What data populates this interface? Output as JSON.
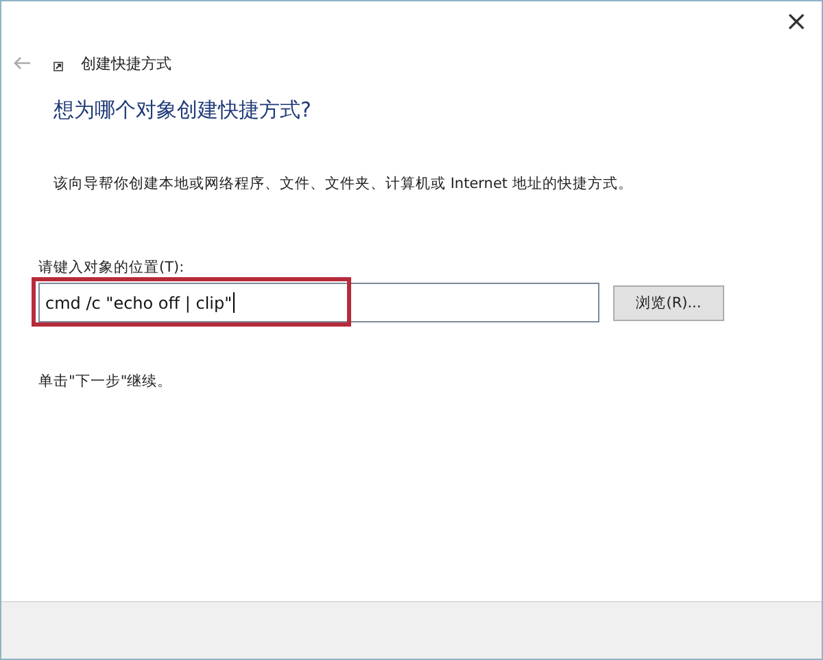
{
  "window": {
    "title": "创建快捷方式",
    "close": "×"
  },
  "heading": "想为哪个对象创建快捷方式?",
  "description": "该向导帮你创建本地或网络程序、文件、文件夹、计算机或 Internet 地址的快捷方式。",
  "location": {
    "label": "请键入对象的位置(T):",
    "value": "cmd /c \"echo off | clip\"",
    "highlighted": true
  },
  "browse_button": "浏览(R)...",
  "hint": "单击\"下一步\"继续。"
}
